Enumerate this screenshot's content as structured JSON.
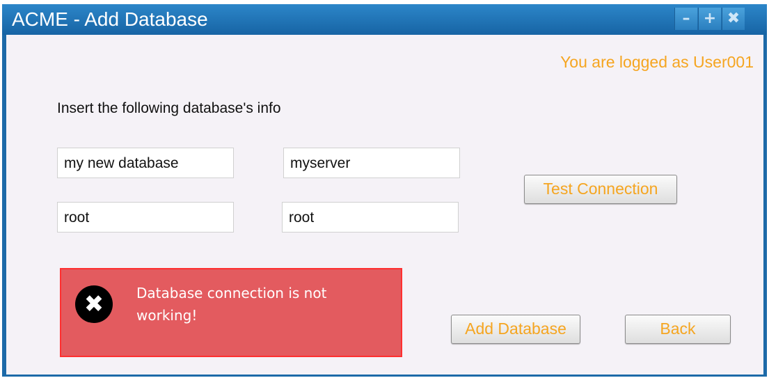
{
  "window": {
    "title": "ACME - Add Database",
    "controls": {
      "minimize": "–",
      "maximize": "+",
      "close": "✖"
    }
  },
  "header": {
    "logged_text": "You are logged as User001"
  },
  "form": {
    "instruction": "Insert the following database's info",
    "fields": {
      "db_name": "my new database",
      "server": "myserver",
      "username": "root",
      "password": "root"
    }
  },
  "buttons": {
    "test_connection": "Test Connection",
    "add_database": "Add Database",
    "back": "Back"
  },
  "error": {
    "icon": "✖",
    "message": "Database connection is not working!"
  },
  "colors": {
    "accent_text": "#f5a520",
    "title_bar": "#1d6aa8",
    "error_bg": "#e35b5f"
  }
}
